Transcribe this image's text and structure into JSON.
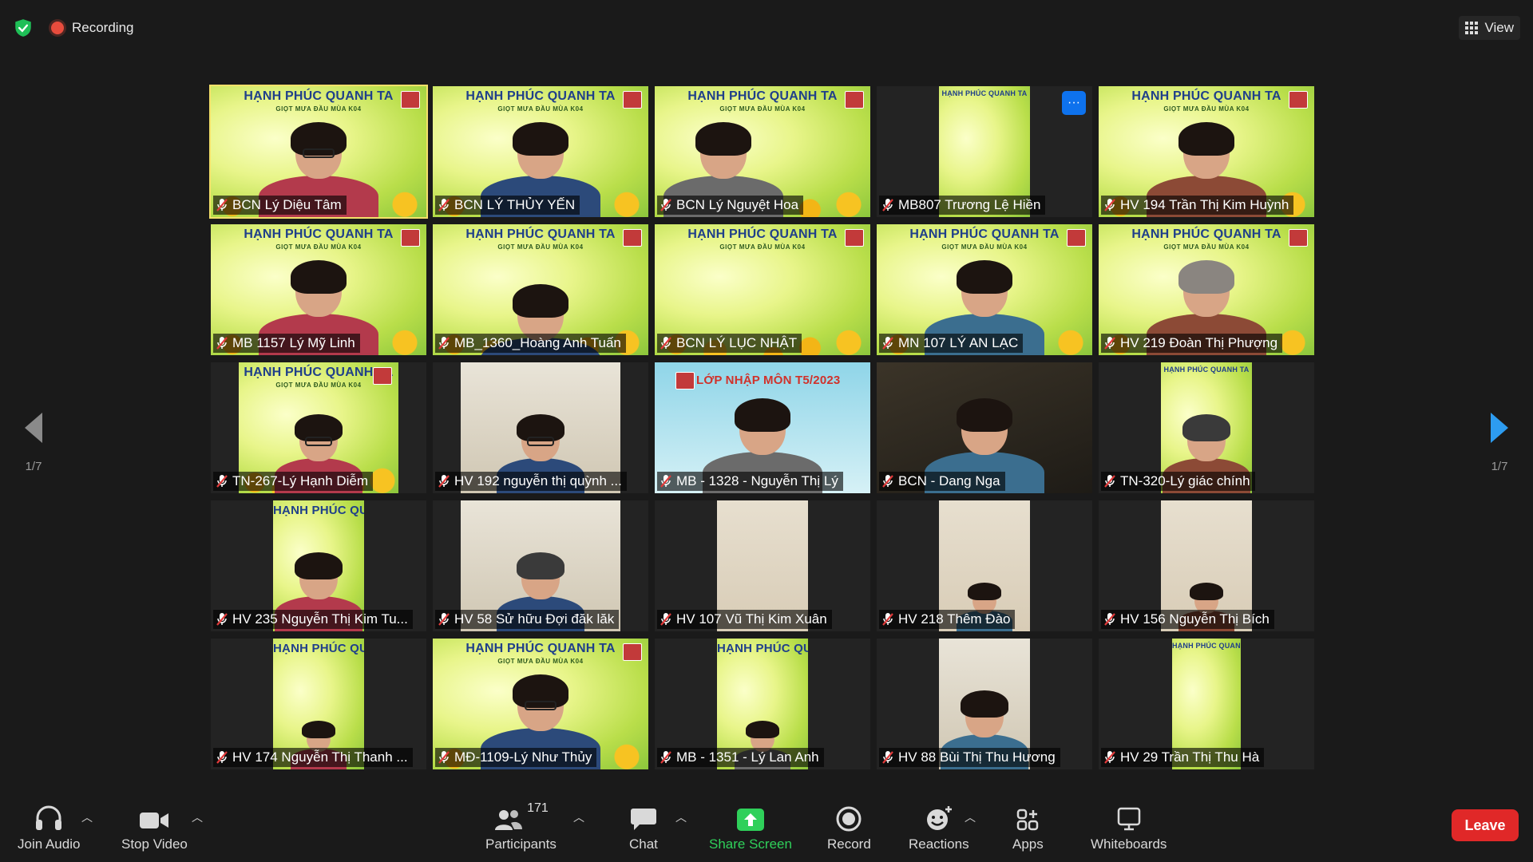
{
  "topbar": {
    "recording_label": "Recording",
    "view_label": "View"
  },
  "pager": {
    "left": "1/7",
    "right": "1/7"
  },
  "banner_text": "HẠNH PHÚC QUANH TA",
  "banner_sub": "GIỌT MƯA ĐẦU MÙA K04",
  "lop_text": "LỚP NHẬP MÔN T5/2023",
  "tiles": [
    {
      "name": "BCN Lý Diệu Tâm"
    },
    {
      "name": "BCN   LÝ THỦY YẾN"
    },
    {
      "name": "BCN Lý Nguyệt Hoa"
    },
    {
      "name": "MB807 Trương Lệ Hiền"
    },
    {
      "name": "HV 194 Trần Thị Kim Huỳnh"
    },
    {
      "name": "MB 1157 Lý Mỹ Linh"
    },
    {
      "name": "MB_1360_Hoàng Anh Tuấn"
    },
    {
      "name": "BCN LÝ LỤC NHẬT"
    },
    {
      "name": "MN 107 LÝ AN LẠC"
    },
    {
      "name": "HV 219 Đoàn Thị Phượng"
    },
    {
      "name": "TN-267-Lý Hạnh Diễm"
    },
    {
      "name": "HV 192 nguyễn thị quỳnh  ..."
    },
    {
      "name": "MB - 1328 - Nguyễn Thị Lý"
    },
    {
      "name": "BCN - Dang Nga"
    },
    {
      "name": "TN-320-Lý giác chính"
    },
    {
      "name": "HV 235 Nguyễn Thị Kim Tu..."
    },
    {
      "name": "HV 58 Sử hữu Đợi đăk lăk"
    },
    {
      "name": "HV 107 Vũ Thị Kim Xuân"
    },
    {
      "name": "HV 218 Thêm Đào"
    },
    {
      "name": "HV 156 Nguyễn Thị Bích"
    },
    {
      "name": "HV 174 Nguyễn Thị Thanh ..."
    },
    {
      "name": "MĐ-1109-Lý Như Thủy"
    },
    {
      "name": "MB - 1351 - Lý Lan Anh"
    },
    {
      "name": "HV 88 Bùi Thị Thu Hương"
    },
    {
      "name": "HV 29 Trần Thị Thu Hà"
    }
  ],
  "toolbar": {
    "join_audio": "Join Audio",
    "stop_video": "Stop Video",
    "participants": "Participants",
    "participants_count": "171",
    "chat": "Chat",
    "share_screen": "Share Screen",
    "record": "Record",
    "reactions": "Reactions",
    "apps": "Apps",
    "whiteboards": "Whiteboards",
    "leave": "Leave"
  },
  "colors": {
    "accent_green": "#2fd05a",
    "leave_red": "#e02828",
    "active_outline": "#f5e16a",
    "more_blue": "#0e72ed"
  }
}
